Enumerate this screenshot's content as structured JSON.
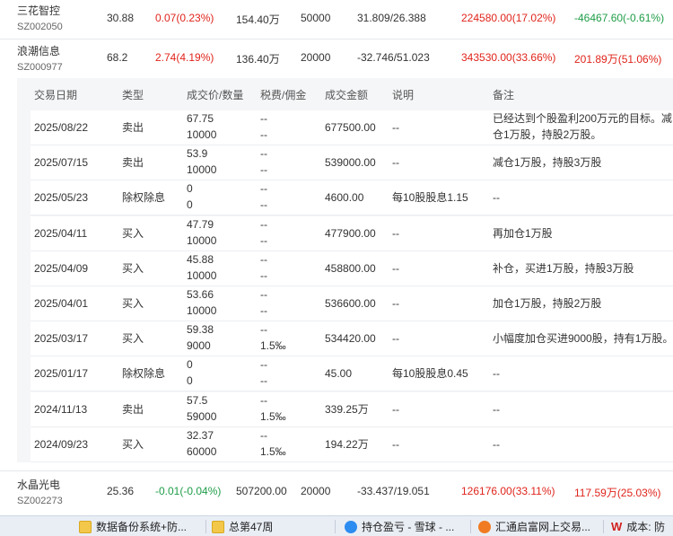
{
  "positions": {
    "top": {
      "name": "三花智控",
      "code": "SZ002050",
      "price": "30.88",
      "change": "0.07(0.23%)",
      "amount": "154.40万",
      "shares": "50000",
      "cost": "31.809/26.388",
      "profit": "224580.00(17.02%)",
      "float_profit": "-46467.60(-0.61%)"
    },
    "second": {
      "name": "浪潮信息",
      "code": "SZ000977",
      "price": "68.2",
      "change": "2.74(4.19%)",
      "amount": "136.40万",
      "shares": "20000",
      "cost": "-32.746/51.023",
      "profit": "343530.00(33.66%)",
      "float_profit": "201.89万(51.06%)"
    },
    "bottom": {
      "name": "水晶光电",
      "code": "SZ002273",
      "price": "25.36",
      "change": "-0.01(-0.04%)",
      "amount": "507200.00",
      "shares": "20000",
      "cost": "-33.437/19.051",
      "profit": "126176.00(33.11%)",
      "float_profit": "117.59万(25.03%)"
    }
  },
  "detail": {
    "headers": {
      "date": "交易日期",
      "type": "类型",
      "price_qty": "成交价/数量",
      "fee": "税费/佣金",
      "amount": "成交金额",
      "desc": "说明",
      "note": "备注"
    },
    "rows": [
      {
        "date": "2025/08/22",
        "type": "卖出",
        "price": "67.75",
        "qty": "10000",
        "fee1": "--",
        "fee2": "--",
        "amount": "677500.00",
        "desc": "--",
        "note1": "已经达到个股盈利200万元的目标。减",
        "note2": "仓1万股，持股2万股。"
      },
      {
        "date": "2025/07/15",
        "type": "卖出",
        "price": "53.9",
        "qty": "10000",
        "fee1": "--",
        "fee2": "--",
        "amount": "539000.00",
        "desc": "--",
        "note1": "减仓1万股，持股3万股",
        "note2": ""
      },
      {
        "date": "2025/05/23",
        "type": "除权除息",
        "price": "0",
        "qty": "0",
        "fee1": "--",
        "fee2": "--",
        "amount": "4600.00",
        "desc": "每10股股息1.15",
        "note1": "--",
        "note2": ""
      },
      {
        "date": "2025/04/11",
        "type": "买入",
        "price": "47.79",
        "qty": "10000",
        "fee1": "--",
        "fee2": "--",
        "amount": "477900.00",
        "desc": "--",
        "note1": "再加仓1万股",
        "note2": ""
      },
      {
        "date": "2025/04/09",
        "type": "买入",
        "price": "45.88",
        "qty": "10000",
        "fee1": "--",
        "fee2": "--",
        "amount": "458800.00",
        "desc": "--",
        "note1": "补仓，买进1万股，持股3万股",
        "note2": ""
      },
      {
        "date": "2025/04/01",
        "type": "买入",
        "price": "53.66",
        "qty": "10000",
        "fee1": "--",
        "fee2": "--",
        "amount": "536600.00",
        "desc": "--",
        "note1": "加仓1万股，持股2万股",
        "note2": ""
      },
      {
        "date": "2025/03/17",
        "type": "买入",
        "price": "59.38",
        "qty": "9000",
        "fee1": "--",
        "fee2": "1.5‰",
        "amount": "534420.00",
        "desc": "--",
        "note1": "小幅度加仓买进9000股，持有1万股。",
        "note2": ""
      },
      {
        "date": "2025/01/17",
        "type": "除权除息",
        "price": "0",
        "qty": "0",
        "fee1": "--",
        "fee2": "--",
        "amount": "45.00",
        "desc": "每10股股息0.45",
        "note1": "--",
        "note2": ""
      },
      {
        "date": "2024/11/13",
        "type": "卖出",
        "price": "57.5",
        "qty": "59000",
        "fee1": "--",
        "fee2": "1.5‰",
        "amount": "339.25万",
        "desc": "--",
        "note1": "--",
        "note2": ""
      },
      {
        "date": "2024/09/23",
        "type": "买入",
        "price": "32.37",
        "qty": "60000",
        "fee1": "--",
        "fee2": "1.5‰",
        "amount": "194.22万",
        "desc": "--",
        "note1": "--",
        "note2": ""
      }
    ]
  },
  "taskbar": [
    {
      "label": "数据备份系统+防...",
      "icon": "folder-icon"
    },
    {
      "label": "总第47周",
      "icon": "folder-icon"
    },
    {
      "label": "持仓盈亏 - 雪球 - ...",
      "icon": "xueqiu-icon"
    },
    {
      "label": "汇通启富网上交易...",
      "icon": "huitong-icon"
    },
    {
      "label": "成本: 防",
      "icon": "wps-icon"
    }
  ],
  "colors": {
    "up": "#e0241b",
    "down": "#1f9d48",
    "panel_bg": "#f5f6f8"
  }
}
